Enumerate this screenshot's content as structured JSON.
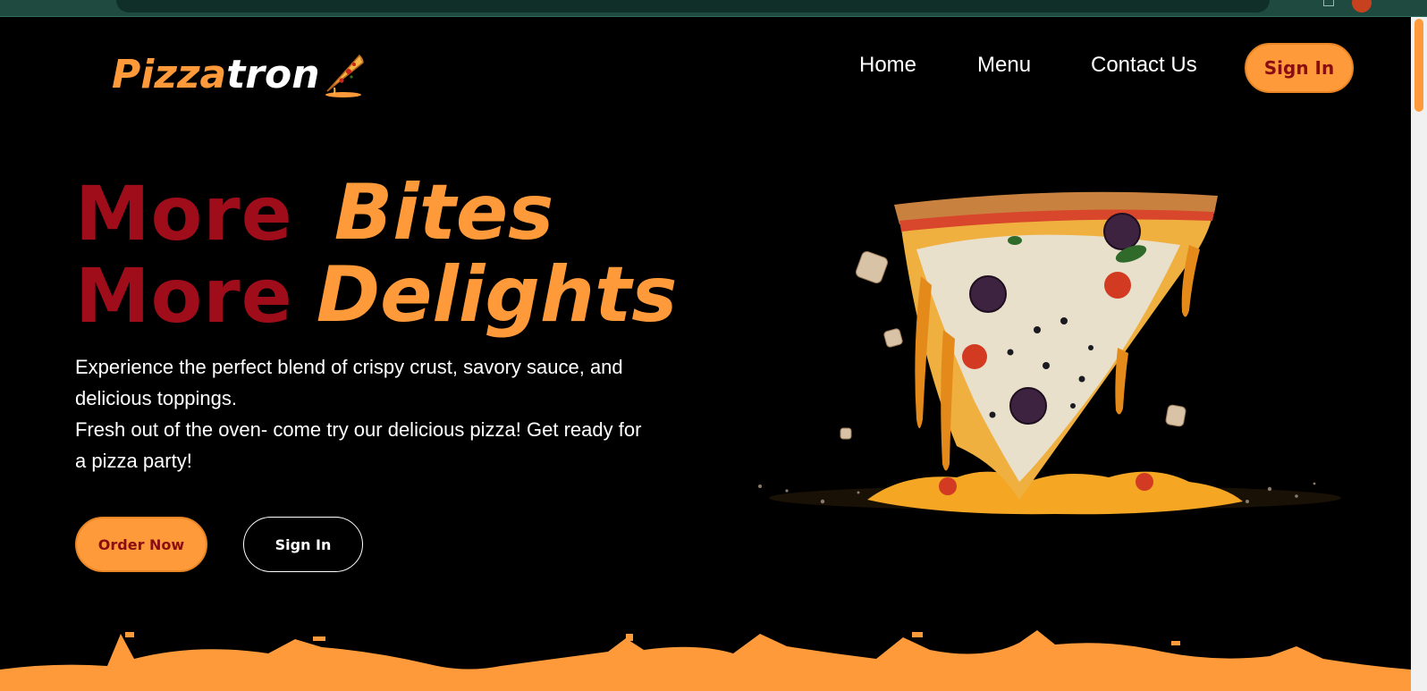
{
  "colors": {
    "accent_orange": "#ff9a3a",
    "accent_red": "#a00d1a",
    "background": "#000000",
    "text": "#ffffff"
  },
  "header": {
    "logo": {
      "part1": "Pizza",
      "part2": "tron"
    },
    "nav": [
      {
        "label": "Home"
      },
      {
        "label": "Menu"
      },
      {
        "label": "Contact Us"
      }
    ],
    "signin_label": "Sign In"
  },
  "hero": {
    "line1": {
      "prefix": "More",
      "accent": "Bites"
    },
    "line2": {
      "prefix": "More",
      "accent": "Delights"
    },
    "paragraph1": "Experience the perfect blend of crispy crust, savory sauce, and delicious toppings.",
    "paragraph2": "Fresh out of the oven- come try our delicious pizza! Get ready for a pizza party!",
    "order_button": "Order Now",
    "signin_button": "Sign In"
  },
  "icons": {
    "logo_slice": "pizza-slice-icon",
    "hero_image": "melting-pizza-slice"
  }
}
